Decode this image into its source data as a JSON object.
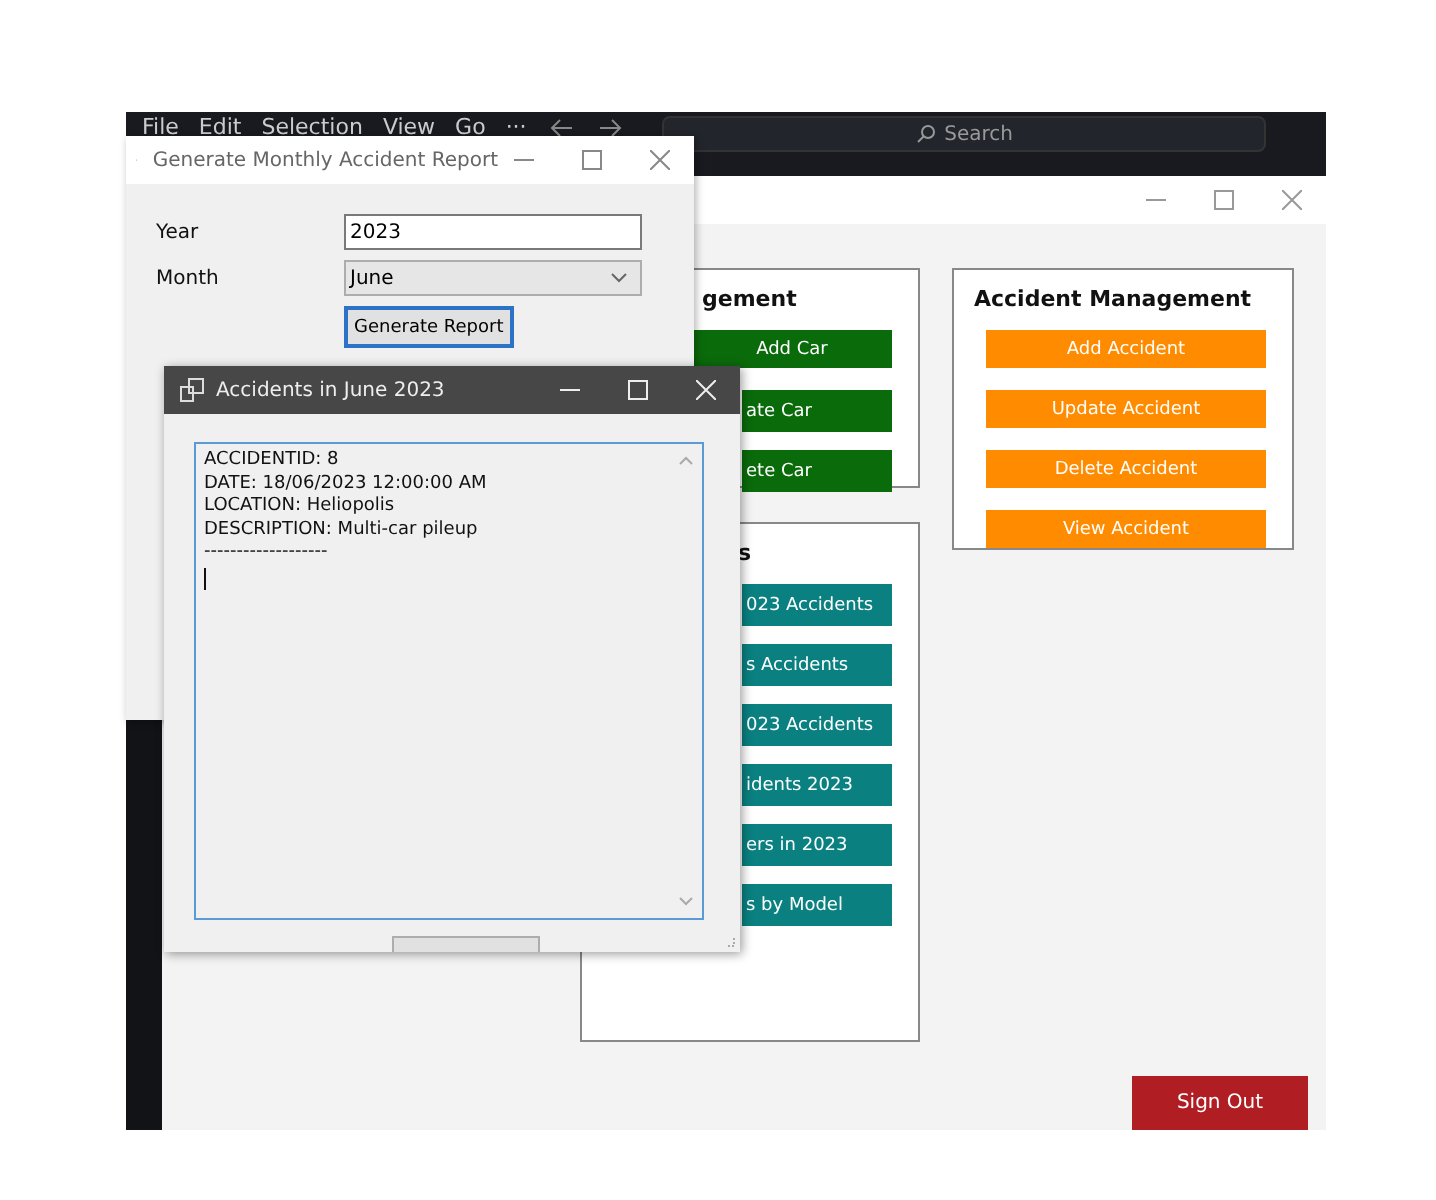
{
  "editor_bar": {
    "menu": [
      "File",
      "Edit",
      "Selection",
      "View",
      "Go",
      "···"
    ],
    "search": {
      "placeholder": "Search"
    }
  },
  "main_window": {
    "groups": [
      {
        "title": "gement",
        "kind": "car",
        "buttons": [
          {
            "label": "Add Car",
            "clipped": false
          },
          {
            "label": "ate Car",
            "clipped": true
          },
          {
            "label": "ete Car",
            "clipped": true
          }
        ]
      },
      {
        "title": "Accident Management",
        "kind": "accident",
        "buttons": [
          {
            "label": "Add Accident",
            "clipped": false
          },
          {
            "label": "Update Accident",
            "clipped": false
          },
          {
            "label": "Delete Accident",
            "clipped": false
          },
          {
            "label": "View Accident",
            "clipped": false
          }
        ]
      },
      {
        "title": "s",
        "kind": "report",
        "buttons": [
          {
            "label": "023 Accidents",
            "clipped": true
          },
          {
            "label": "s Accidents",
            "clipped": true
          },
          {
            "label": "023 Accidents",
            "clipped": true
          },
          {
            "label": "idents 2023",
            "clipped": true
          },
          {
            "label": "ers in 2023",
            "clipped": true
          },
          {
            "label": "s by Model",
            "clipped": true
          }
        ]
      }
    ],
    "sign_out": "Sign Out"
  },
  "report_window": {
    "title": "Generate Monthly Accident Report",
    "year_label": "Year",
    "year_value": "2023",
    "month_label": "Month",
    "month_value": "June",
    "button": "Generate Report"
  },
  "result_window": {
    "title": "Accidents in June 2023",
    "lines": [
      "ACCIDENTID: 8",
      "DATE: 18/06/2023 12:00:00 AM",
      "LOCATION: Heliopolis",
      "DESCRIPTION: Multi-car pileup",
      "-------------------"
    ]
  }
}
